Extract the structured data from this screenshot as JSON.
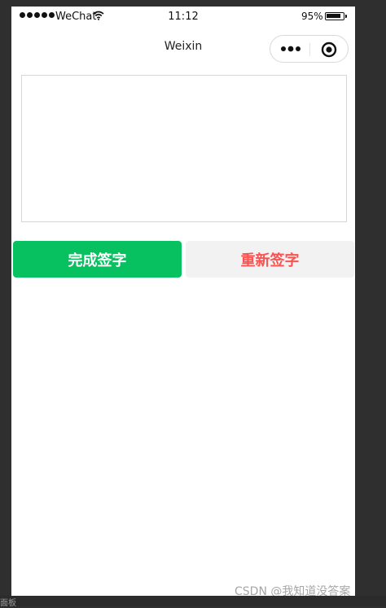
{
  "status_bar": {
    "carrier": "WeChat",
    "time": "11:12",
    "battery": "95%",
    "battery_level": 0.95,
    "signal_icon": "signal-dots-icon",
    "wifi_icon": "wifi-icon"
  },
  "nav": {
    "title": "Weixin",
    "more_icon": "more-dots-icon",
    "close_icon": "record-circle-icon"
  },
  "buttons": {
    "done_label": "完成签字",
    "reset_label": "重新签字"
  },
  "colors": {
    "done_bg": "#07c160",
    "reset_text": "#fa5151",
    "reset_bg": "#f2f2f2"
  },
  "watermark": "CSDN @我知道没答案",
  "bottom_text": "面板"
}
